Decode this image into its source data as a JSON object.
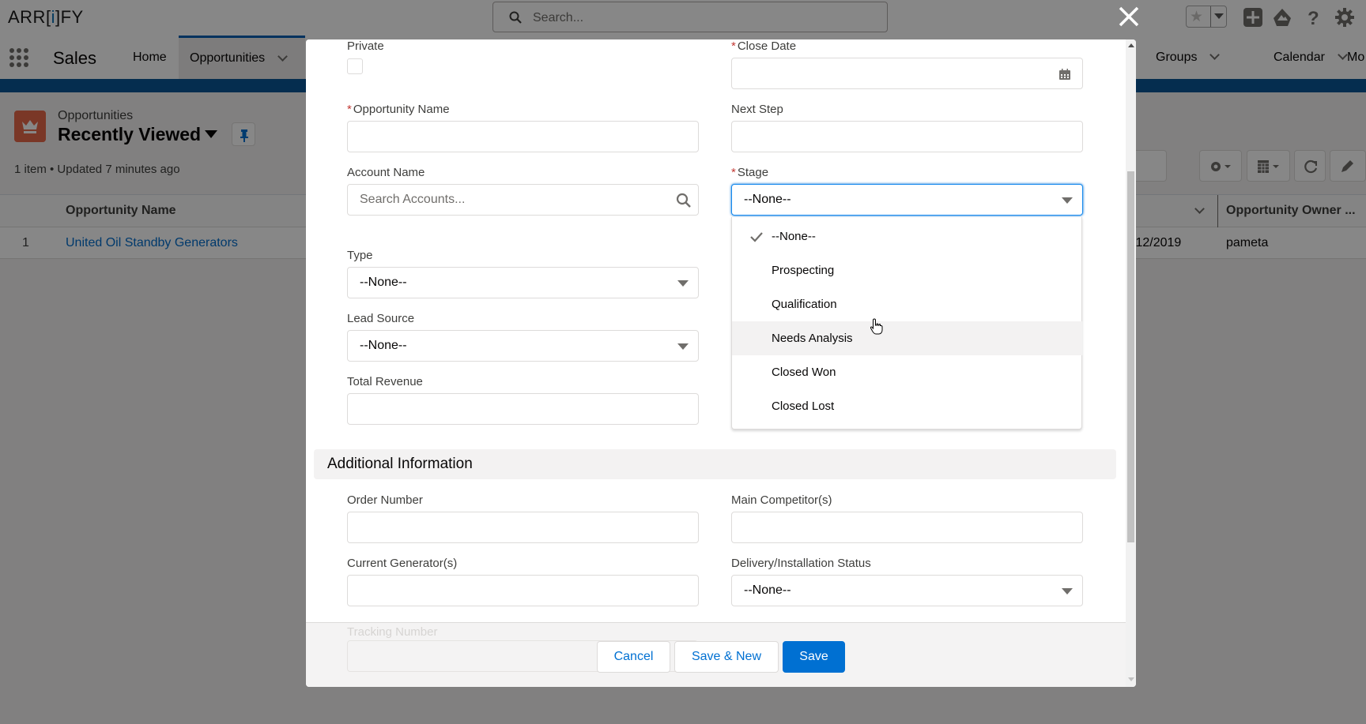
{
  "app": {
    "logo_prefix": "ARR[",
    "logo_mid": "i",
    "logo_suffix": "]FY",
    "search_placeholder": "Search...",
    "app_name": "Sales",
    "nav_items": [
      {
        "label": "Home",
        "active": false
      },
      {
        "label": "Opportunities",
        "active": true
      },
      {
        "label": "Groups",
        "active": false
      },
      {
        "label": "Calendar",
        "active": false
      },
      {
        "label": "Mo",
        "active": false
      }
    ]
  },
  "list_view": {
    "object_label": "Opportunities",
    "title": "Recently Viewed",
    "meta": "1 item • Updated 7 minutes ago",
    "columns": [
      "Opportunity Name",
      "Opportunity Owner ..."
    ],
    "rows": [
      {
        "num": "1",
        "name": "United Oil Standby Generators",
        "date_fragment": "/12/2019",
        "owner": "pameta"
      }
    ]
  },
  "modal": {
    "fields_left": [
      {
        "label": "Private",
        "type": "checkbox",
        "checked": false
      },
      {
        "label": "Opportunity Name",
        "required": true,
        "value": ""
      },
      {
        "label": "Account Name",
        "placeholder": "Search Accounts..."
      },
      {
        "label": "Type",
        "type": "select",
        "value": "--None--"
      },
      {
        "label": "Lead Source",
        "type": "select",
        "value": "--None--"
      },
      {
        "label": "Total Revenue",
        "value": ""
      }
    ],
    "fields_right": [
      {
        "label": "Close Date",
        "required": true,
        "value": ""
      },
      {
        "label": "Next Step",
        "value": ""
      },
      {
        "label": "Stage",
        "required": true,
        "type": "select",
        "value": "--None--"
      }
    ],
    "required_marker": "*",
    "stage_options": [
      {
        "label": "--None--",
        "selected": true
      },
      {
        "label": "Prospecting"
      },
      {
        "label": "Qualification"
      },
      {
        "label": "Needs Analysis",
        "hovered": true
      },
      {
        "label": "Closed Won"
      },
      {
        "label": "Closed Lost"
      }
    ],
    "section_title": "Additional Information",
    "additional_fields": [
      {
        "label": "Order Number",
        "value": ""
      },
      {
        "label": "Main Competitor(s)",
        "value": ""
      },
      {
        "label": "Current Generator(s)",
        "value": ""
      },
      {
        "label": "Delivery/Installation Status",
        "type": "select",
        "value": "--None--"
      },
      {
        "label": "Tracking Number",
        "value": ""
      }
    ],
    "buttons": {
      "cancel": "Cancel",
      "save_new": "Save & New",
      "save": "Save"
    }
  },
  "colors": {
    "brand": "#0070d2",
    "required": "#c23934",
    "object_icon": "#e6684b",
    "focus": "#1589ee"
  }
}
